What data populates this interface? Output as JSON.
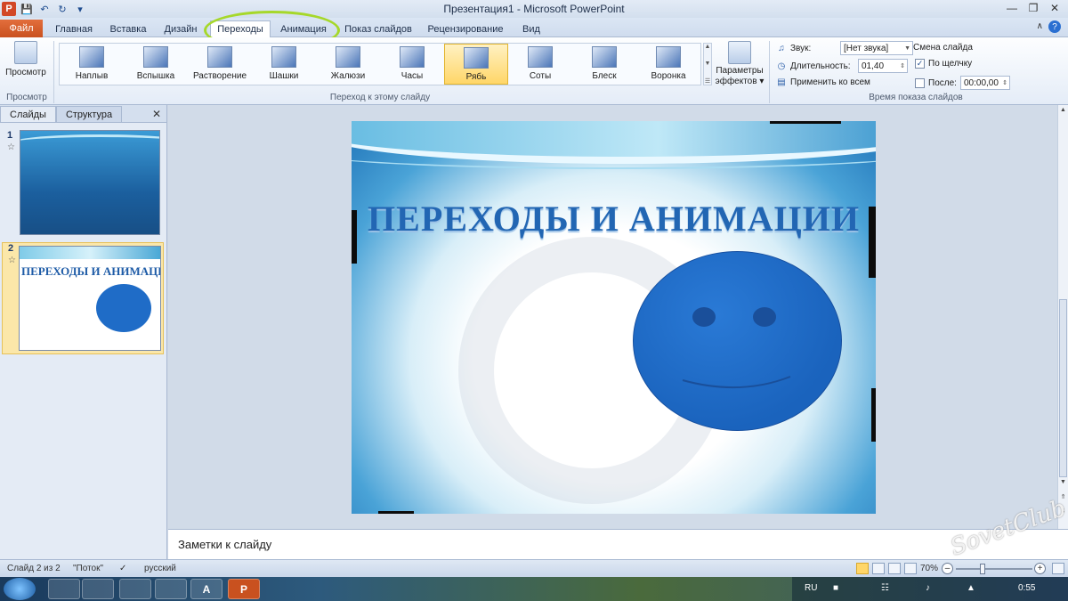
{
  "window": {
    "title": "Презентация1 - Microsoft PowerPoint",
    "app_letter": "P"
  },
  "tabs": {
    "file": "Файл",
    "items": [
      "Главная",
      "Вставка",
      "Дизайн",
      "Переходы",
      "Анимация",
      "Показ слайдов",
      "Рецензирование",
      "Вид"
    ],
    "active": "Переходы"
  },
  "ribbon": {
    "preview": {
      "label": "Просмотр",
      "group": "Просмотр"
    },
    "transitions": {
      "items": [
        "Наплыв",
        "Вспышка",
        "Растворение",
        "Шашки",
        "Жалюзи",
        "Часы",
        "Рябь",
        "Соты",
        "Блеск",
        "Воронка"
      ],
      "selected": "Рябь",
      "group": "Переход к этому слайду"
    },
    "effects": {
      "label_line1": "Параметры",
      "label_line2": "эффектов"
    },
    "timing": {
      "sound_label": "Звук:",
      "sound_value": "[Нет звука]",
      "duration_label": "Длительность:",
      "duration_value": "01,40",
      "apply_all": "Применить ко всем",
      "advance_title": "Смена слайда",
      "on_click": "По щелчку",
      "on_click_checked": true,
      "after_label": "После:",
      "after_value": "00:00,00",
      "after_checked": false,
      "group": "Время показа слайдов"
    }
  },
  "left_pane": {
    "tab_slides": "Слайды",
    "tab_outline": "Структура",
    "slides": [
      {
        "num": "1"
      },
      {
        "num": "2",
        "title": "ПЕРЕХОДЫ И АНИМАЦИИ"
      }
    ]
  },
  "slide": {
    "title": "ПЕРЕХОДЫ И АНИМАЦИИ"
  },
  "notes": {
    "placeholder": "Заметки к слайду"
  },
  "status": {
    "slide_info": "Слайд 2 из 2",
    "theme": "\"Поток\"",
    "language": "русский",
    "zoom": "70%"
  },
  "taskbar": {
    "lang": "RU",
    "time": "0:55",
    "app_a": "A",
    "app_p": "P"
  },
  "watermark": "SovetClub",
  "colors": {
    "accent_blue": "#2266b3",
    "highlight_green": "#a6d82a",
    "file_tab": "#d24726",
    "selected_gold": "#ffd668"
  }
}
